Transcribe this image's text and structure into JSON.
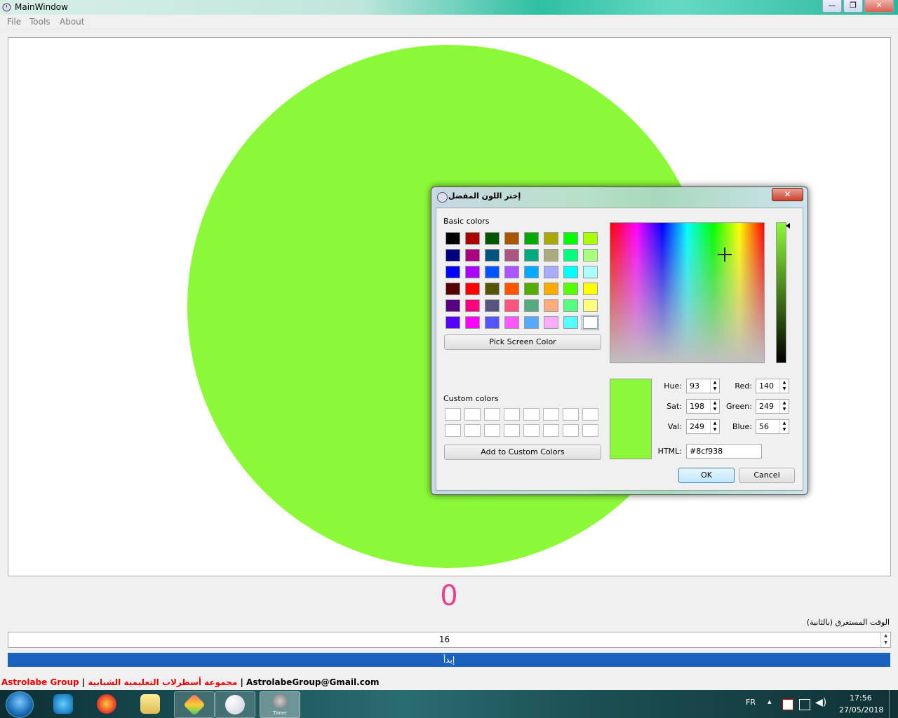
{
  "window": {
    "title": "MainWindow",
    "btn_min": "—",
    "btn_max": "❐",
    "btn_close": "✕"
  },
  "menubar": {
    "items": [
      "File",
      "Tools",
      "About"
    ]
  },
  "canvas": {
    "circle_color": "#8cf938"
  },
  "counter": {
    "value": "0"
  },
  "elapsed": {
    "label": "الوقت المستغرق (بالثانية)",
    "value": "16"
  },
  "start_button": {
    "label": "إبدأ"
  },
  "footer": {
    "brand_en": "Astrolabe Group",
    "separator1": " | ",
    "brand_ar": "مجموعة أسطرلاب التعليمية الشبابية",
    "separator2": " | ",
    "email": "AstrolabeGroup@Gmail.com"
  },
  "dialog": {
    "title": "إختر اللون المفضل",
    "close": "✕",
    "basic_colors_label": "Basic colors",
    "basic_colors": [
      [
        "#000000",
        "#aa0000",
        "#005500",
        "#aa5500",
        "#00aa00",
        "#aaaa00",
        "#00ff00",
        "#aaff00"
      ],
      [
        "#00007f",
        "#aa007f",
        "#00557f",
        "#aa557f",
        "#00aa7f",
        "#aaaa7f",
        "#00ff7f",
        "#aaff7f"
      ],
      [
        "#0000ff",
        "#aa00ff",
        "#0055ff",
        "#aa55ff",
        "#00aaff",
        "#aaaaff",
        "#00ffff",
        "#aaffff"
      ],
      [
        "#550000",
        "#ff0000",
        "#555500",
        "#ff5500",
        "#55aa00",
        "#ffaa00",
        "#55ff00",
        "#ffff00"
      ],
      [
        "#55007f",
        "#ff007f",
        "#55557f",
        "#ff557f",
        "#55aa7f",
        "#ffaa7f",
        "#55ff7f",
        "#ffff7f"
      ],
      [
        "#5500ff",
        "#ff00ff",
        "#5555ff",
        "#ff55ff",
        "#55aaff",
        "#ffaaff",
        "#55ffff",
        "#ffffff"
      ]
    ],
    "pick_screen_color": "Pick Screen Color",
    "custom_colors_label": "Custom colors",
    "add_custom": "Add to Custom Colors",
    "fields": {
      "hue_label": "Hue:",
      "hue": "93",
      "sat_label": "Sat:",
      "sat": "198",
      "val_label": "Val:",
      "val": "249",
      "red_label": "Red:",
      "red": "140",
      "green_label": "Green:",
      "green": "249",
      "blue_label": "Blue:",
      "blue": "56",
      "html_label": "HTML:",
      "html": "#8cf938"
    },
    "ok": "OK",
    "cancel": "Cancel",
    "preview_color": "#8cf938"
  },
  "taskbar": {
    "apps": [
      "internet-explorer",
      "firefox",
      "file-explorer",
      "git",
      "paint",
      "timer"
    ],
    "timer_label": "Timer",
    "lang": "FR",
    "time": "17:56",
    "date": "27/05/2018"
  }
}
